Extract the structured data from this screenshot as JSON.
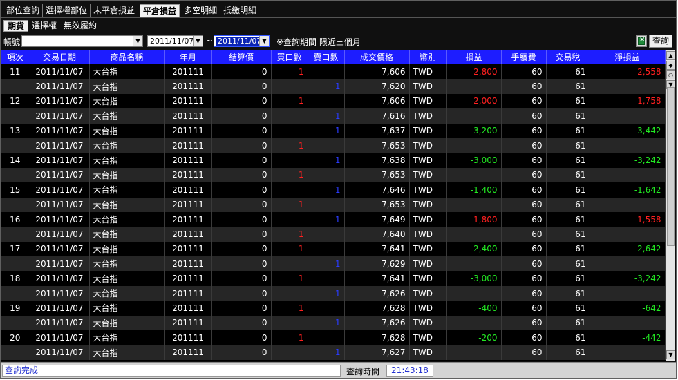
{
  "tabs": [
    "部位查詢",
    "選擇權部位",
    "未平倉損益",
    "平倉損益",
    "多空明細",
    "抵繳明細"
  ],
  "active_tab_index": 3,
  "sub_tabs": [
    "期貨",
    "選擇權",
    "無效履約"
  ],
  "active_sub_tab_index": 0,
  "filter": {
    "account_label": "帳號",
    "account_value": "",
    "date_from": "2011/11/07",
    "date_separator": "~",
    "date_to": "2011/11/07",
    "period_note": "※查詢期間 限近三個月",
    "query_button": "查詢",
    "export_icon": "excel-export-icon"
  },
  "table": {
    "headers": [
      "項次",
      "交易日期",
      "商品名稱",
      "年月",
      "結算價",
      "買口數",
      "賣口數",
      "成交價格",
      "幣別",
      "損益",
      "手續費",
      "交易稅",
      "淨損益"
    ],
    "rows": [
      {
        "id": "11",
        "date": "2011/11/07",
        "product": "大台指",
        "ym": "201111",
        "settle": "0",
        "buy": "1",
        "sell": "",
        "price": "7,606",
        "cur": "TWD",
        "pnl": "2,800",
        "fee": "60",
        "tax": "61",
        "net": "2,558"
      },
      {
        "id": "",
        "date": "2011/11/07",
        "product": "大台指",
        "ym": "201111",
        "settle": "0",
        "buy": "",
        "sell": "1",
        "price": "7,620",
        "cur": "TWD",
        "pnl": "",
        "fee": "60",
        "tax": "61",
        "net": ""
      },
      {
        "id": "12",
        "date": "2011/11/07",
        "product": "大台指",
        "ym": "201111",
        "settle": "0",
        "buy": "1",
        "sell": "",
        "price": "7,606",
        "cur": "TWD",
        "pnl": "2,000",
        "fee": "60",
        "tax": "61",
        "net": "1,758"
      },
      {
        "id": "",
        "date": "2011/11/07",
        "product": "大台指",
        "ym": "201111",
        "settle": "0",
        "buy": "",
        "sell": "1",
        "price": "7,616",
        "cur": "TWD",
        "pnl": "",
        "fee": "60",
        "tax": "61",
        "net": ""
      },
      {
        "id": "13",
        "date": "2011/11/07",
        "product": "大台指",
        "ym": "201111",
        "settle": "0",
        "buy": "",
        "sell": "1",
        "price": "7,637",
        "cur": "TWD",
        "pnl": "-3,200",
        "fee": "60",
        "tax": "61",
        "net": "-3,442"
      },
      {
        "id": "",
        "date": "2011/11/07",
        "product": "大台指",
        "ym": "201111",
        "settle": "0",
        "buy": "1",
        "sell": "",
        "price": "7,653",
        "cur": "TWD",
        "pnl": "",
        "fee": "60",
        "tax": "61",
        "net": ""
      },
      {
        "id": "14",
        "date": "2011/11/07",
        "product": "大台指",
        "ym": "201111",
        "settle": "0",
        "buy": "",
        "sell": "1",
        "price": "7,638",
        "cur": "TWD",
        "pnl": "-3,000",
        "fee": "60",
        "tax": "61",
        "net": "-3,242"
      },
      {
        "id": "",
        "date": "2011/11/07",
        "product": "大台指",
        "ym": "201111",
        "settle": "0",
        "buy": "1",
        "sell": "",
        "price": "7,653",
        "cur": "TWD",
        "pnl": "",
        "fee": "60",
        "tax": "61",
        "net": ""
      },
      {
        "id": "15",
        "date": "2011/11/07",
        "product": "大台指",
        "ym": "201111",
        "settle": "0",
        "buy": "",
        "sell": "1",
        "price": "7,646",
        "cur": "TWD",
        "pnl": "-1,400",
        "fee": "60",
        "tax": "61",
        "net": "-1,642"
      },
      {
        "id": "",
        "date": "2011/11/07",
        "product": "大台指",
        "ym": "201111",
        "settle": "0",
        "buy": "1",
        "sell": "",
        "price": "7,653",
        "cur": "TWD",
        "pnl": "",
        "fee": "60",
        "tax": "61",
        "net": ""
      },
      {
        "id": "16",
        "date": "2011/11/07",
        "product": "大台指",
        "ym": "201111",
        "settle": "0",
        "buy": "",
        "sell": "1",
        "price": "7,649",
        "cur": "TWD",
        "pnl": "1,800",
        "fee": "60",
        "tax": "61",
        "net": "1,558"
      },
      {
        "id": "",
        "date": "2011/11/07",
        "product": "大台指",
        "ym": "201111",
        "settle": "0",
        "buy": "1",
        "sell": "",
        "price": "7,640",
        "cur": "TWD",
        "pnl": "",
        "fee": "60",
        "tax": "61",
        "net": ""
      },
      {
        "id": "17",
        "date": "2011/11/07",
        "product": "大台指",
        "ym": "201111",
        "settle": "0",
        "buy": "1",
        "sell": "",
        "price": "7,641",
        "cur": "TWD",
        "pnl": "-2,400",
        "fee": "60",
        "tax": "61",
        "net": "-2,642"
      },
      {
        "id": "",
        "date": "2011/11/07",
        "product": "大台指",
        "ym": "201111",
        "settle": "0",
        "buy": "",
        "sell": "1",
        "price": "7,629",
        "cur": "TWD",
        "pnl": "",
        "fee": "60",
        "tax": "61",
        "net": ""
      },
      {
        "id": "18",
        "date": "2011/11/07",
        "product": "大台指",
        "ym": "201111",
        "settle": "0",
        "buy": "1",
        "sell": "",
        "price": "7,641",
        "cur": "TWD",
        "pnl": "-3,000",
        "fee": "60",
        "tax": "61",
        "net": "-3,242"
      },
      {
        "id": "",
        "date": "2011/11/07",
        "product": "大台指",
        "ym": "201111",
        "settle": "0",
        "buy": "",
        "sell": "1",
        "price": "7,626",
        "cur": "TWD",
        "pnl": "",
        "fee": "60",
        "tax": "61",
        "net": ""
      },
      {
        "id": "19",
        "date": "2011/11/07",
        "product": "大台指",
        "ym": "201111",
        "settle": "0",
        "buy": "1",
        "sell": "",
        "price": "7,628",
        "cur": "TWD",
        "pnl": "-400",
        "fee": "60",
        "tax": "61",
        "net": "-642"
      },
      {
        "id": "",
        "date": "2011/11/07",
        "product": "大台指",
        "ym": "201111",
        "settle": "0",
        "buy": "",
        "sell": "1",
        "price": "7,626",
        "cur": "TWD",
        "pnl": "",
        "fee": "60",
        "tax": "61",
        "net": ""
      },
      {
        "id": "20",
        "date": "2011/11/07",
        "product": "大台指",
        "ym": "201111",
        "settle": "0",
        "buy": "1",
        "sell": "",
        "price": "7,628",
        "cur": "TWD",
        "pnl": "-200",
        "fee": "60",
        "tax": "61",
        "net": "-442"
      },
      {
        "id": "",
        "date": "2011/11/07",
        "product": "大台指",
        "ym": "201111",
        "settle": "0",
        "buy": "",
        "sell": "1",
        "price": "7,627",
        "cur": "TWD",
        "pnl": "",
        "fee": "60",
        "tax": "61",
        "net": ""
      }
    ]
  },
  "status": {
    "text": "查詢完成",
    "query_time_label": "查詢時間",
    "query_time": "21:43:18"
  },
  "colors": {
    "header_bg": "#1d1dff",
    "profit": "#ff2020",
    "loss": "#22e822",
    "sell": "#2a3cff",
    "buy": "#ff2020"
  }
}
